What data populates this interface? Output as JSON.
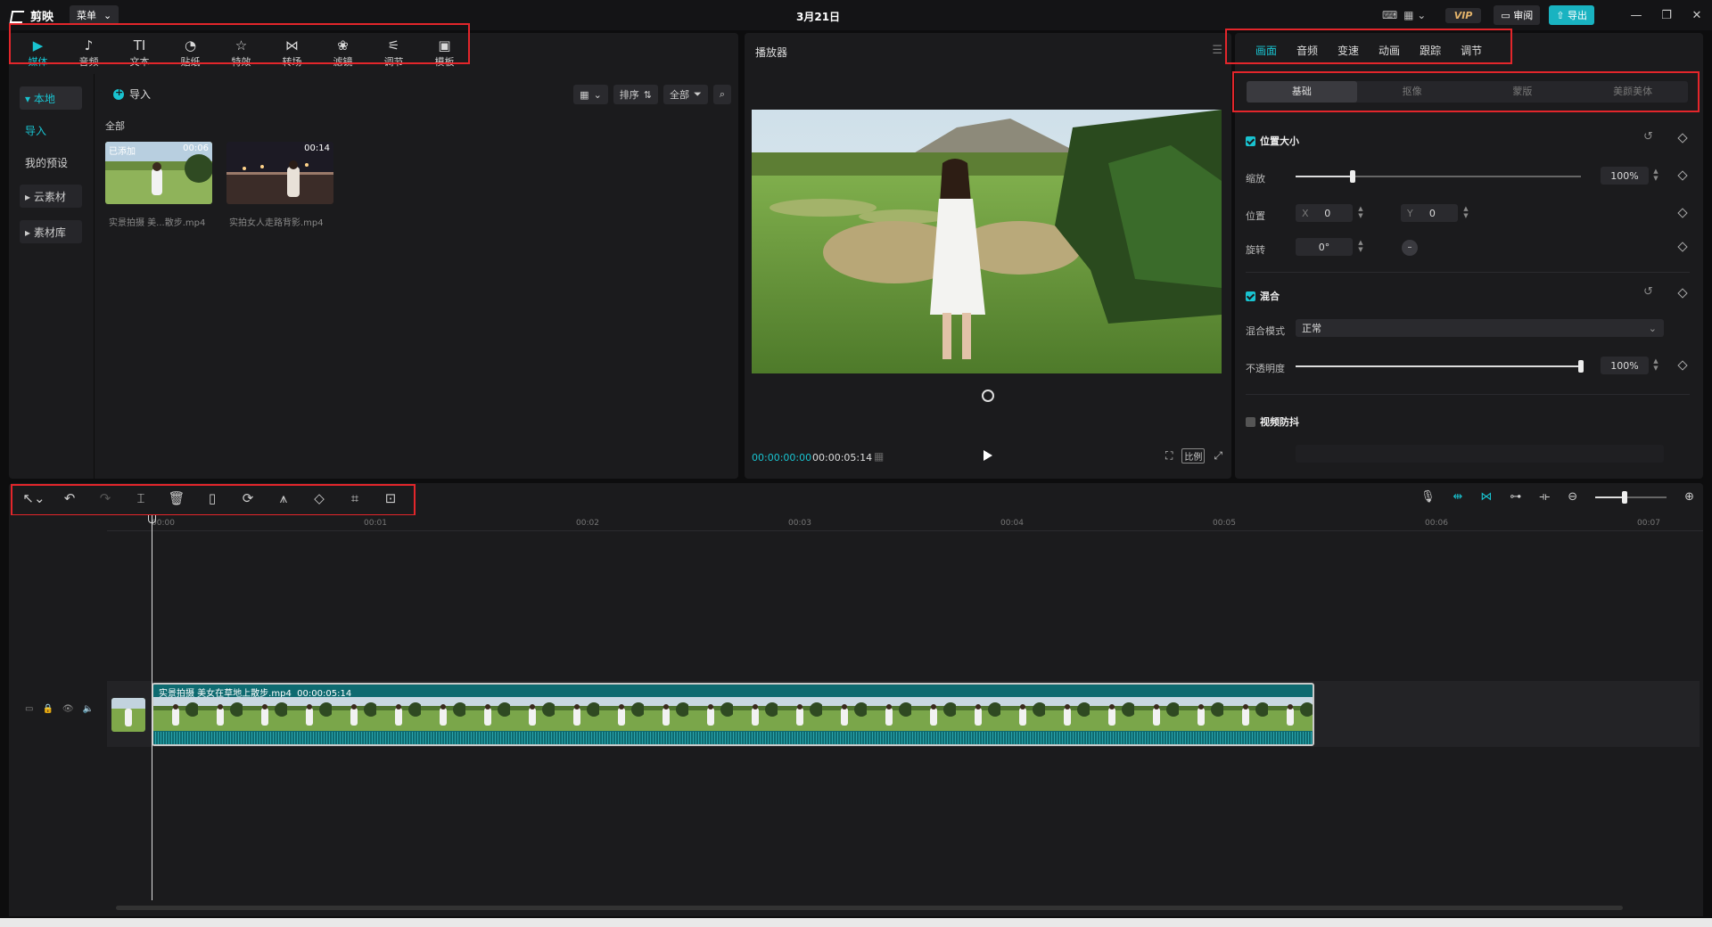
{
  "titlebar": {
    "app_name": "剪映",
    "menu_label": "菜单",
    "date_title": "3月21日",
    "vip_label": "VIP",
    "review_label": "审阅",
    "export_label": "导出"
  },
  "media_toolbar": [
    {
      "label": "媒体",
      "icon": "media-icon",
      "glyph": "▶",
      "active": true
    },
    {
      "label": "音频",
      "icon": "audio-icon",
      "glyph": "♪",
      "active": false
    },
    {
      "label": "文本",
      "icon": "text-icon",
      "glyph": "TI",
      "active": false
    },
    {
      "label": "贴纸",
      "icon": "sticker-icon",
      "glyph": "◔",
      "active": false
    },
    {
      "label": "特效",
      "icon": "effects-icon",
      "glyph": "☆",
      "active": false
    },
    {
      "label": "转场",
      "icon": "transition-icon",
      "glyph": "⋈",
      "active": false
    },
    {
      "label": "滤镜",
      "icon": "filter-icon",
      "glyph": "❀",
      "active": false
    },
    {
      "label": "调节",
      "icon": "adjust-icon",
      "glyph": "⚟",
      "active": false
    },
    {
      "label": "模板",
      "icon": "template-icon",
      "glyph": "▣",
      "active": false
    }
  ],
  "side_nav": {
    "local": "▾ 本地",
    "import": "导入",
    "my_presets": "我的预设",
    "cloud": "▸ 云素材",
    "library": "▸ 素材库"
  },
  "media": {
    "import_label": "导入",
    "sort_label": "排序",
    "filter_label": "全部",
    "all_label": "全部",
    "items": [
      {
        "name": "实景拍摄 美...散步.mp4",
        "duration": "00:06",
        "badge": "已添加"
      },
      {
        "name": "实拍女人走路背影.mp4",
        "duration": "00:14",
        "badge": ""
      }
    ]
  },
  "player": {
    "title": "播放器",
    "current_time": "00:00:00:00",
    "total_time": "00:00:05:14",
    "ratio_label": "比例"
  },
  "properties": {
    "tabs": [
      {
        "label": "画面",
        "active": true
      },
      {
        "label": "音频",
        "active": false
      },
      {
        "label": "变速",
        "active": false
      },
      {
        "label": "动画",
        "active": false
      },
      {
        "label": "跟踪",
        "active": false
      },
      {
        "label": "调节",
        "active": false
      }
    ],
    "subtabs": [
      {
        "label": "基础",
        "active": true
      },
      {
        "label": "抠像",
        "active": false
      },
      {
        "label": "蒙版",
        "active": false
      },
      {
        "label": "美颜美体",
        "active": false
      }
    ],
    "position_size": {
      "title": "位置大小",
      "scale_label": "缩放",
      "scale_value": "100%",
      "scale_fraction": 0.2,
      "position_label": "位置",
      "x_label": "X",
      "x_value": "0",
      "y_label": "Y",
      "y_value": "0",
      "rotate_label": "旋转",
      "rotate_value": "0°"
    },
    "blend": {
      "title": "混合",
      "mode_label": "混合模式",
      "mode_value": "正常",
      "opacity_label": "不透明度",
      "opacity_value": "100%",
      "opacity_fraction": 1.0
    },
    "stabilize": {
      "title": "视频防抖"
    }
  },
  "timeline": {
    "ticks": [
      "00:00",
      "00:01",
      "00:02",
      "00:03",
      "00:04",
      "00:05",
      "00:06",
      "00:07"
    ],
    "clip_name": "实景拍摄 美女在草地上散步.mp4",
    "clip_duration": "00:00:05:14"
  },
  "colors": {
    "accent": "#19c3d0",
    "highlight_box": "#e3262b",
    "clip": "#0e6a70"
  }
}
